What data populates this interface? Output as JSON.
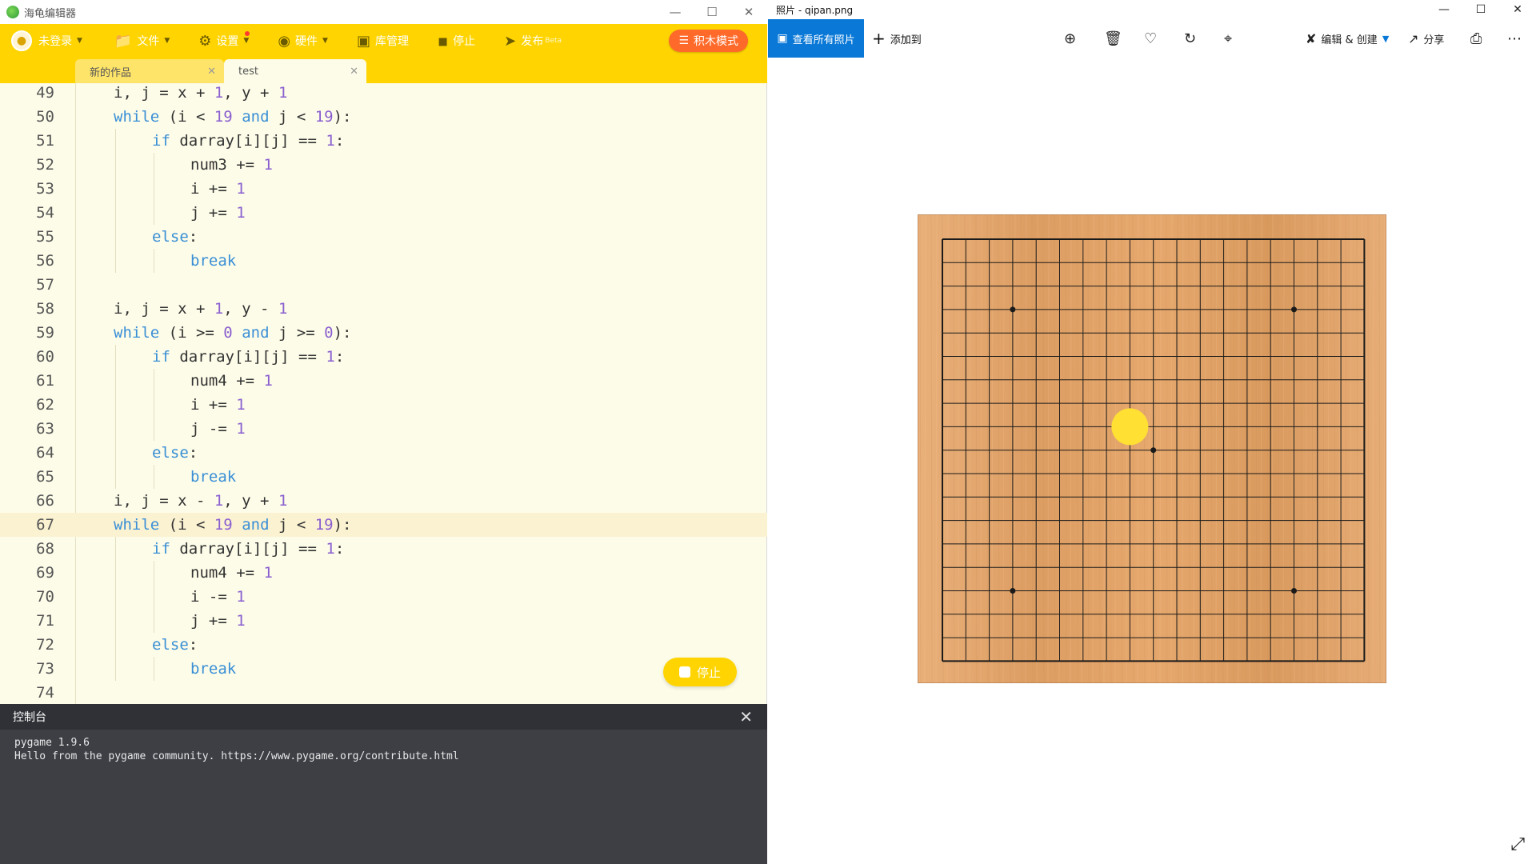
{
  "editor": {
    "window_title": "海龟编辑器",
    "toolbar": {
      "login": "未登录",
      "file": "文件",
      "settings": "设置",
      "hardware": "硬件",
      "library": "库管理",
      "stop": "停止",
      "publish": "发布",
      "publish_badge": "Beta",
      "block_mode": "积木模式"
    },
    "tabs": [
      {
        "label": "新的作品"
      },
      {
        "label": "test"
      }
    ],
    "current_line": 67,
    "lines": [
      {
        "n": "49",
        "indent": 1,
        "code": "i, j = x + 1, y + 1"
      },
      {
        "n": "50",
        "indent": 1,
        "code": "while (i < 19 and j < 19):"
      },
      {
        "n": "51",
        "indent": 2,
        "code": "if darray[i][j] == 1:"
      },
      {
        "n": "52",
        "indent": 3,
        "code": "num3 += 1"
      },
      {
        "n": "53",
        "indent": 3,
        "code": "i += 1"
      },
      {
        "n": "54",
        "indent": 3,
        "code": "j += 1"
      },
      {
        "n": "55",
        "indent": 2,
        "code": "else:"
      },
      {
        "n": "56",
        "indent": 3,
        "code": "break"
      },
      {
        "n": "57",
        "indent": 0,
        "code": ""
      },
      {
        "n": "58",
        "indent": 1,
        "code": "i, j = x + 1, y - 1"
      },
      {
        "n": "59",
        "indent": 1,
        "code": "while (i >= 0 and j >= 0):"
      },
      {
        "n": "60",
        "indent": 2,
        "code": "if darray[i][j] == 1:"
      },
      {
        "n": "61",
        "indent": 3,
        "code": "num4 += 1"
      },
      {
        "n": "62",
        "indent": 3,
        "code": "i += 1"
      },
      {
        "n": "63",
        "indent": 3,
        "code": "j -= 1"
      },
      {
        "n": "64",
        "indent": 2,
        "code": "else:"
      },
      {
        "n": "65",
        "indent": 3,
        "code": "break"
      },
      {
        "n": "66",
        "indent": 1,
        "code": "i, j = x - 1, y + 1"
      },
      {
        "n": "67",
        "indent": 1,
        "code": "while (i < 19 and j < 19):"
      },
      {
        "n": "68",
        "indent": 2,
        "code": "if darray[i][j] == 1:"
      },
      {
        "n": "69",
        "indent": 3,
        "code": "num4 += 1"
      },
      {
        "n": "70",
        "indent": 3,
        "code": "i -= 1"
      },
      {
        "n": "71",
        "indent": 3,
        "code": "j += 1"
      },
      {
        "n": "72",
        "indent": 2,
        "code": "else:"
      },
      {
        "n": "73",
        "indent": 3,
        "code": "break"
      },
      {
        "n": "74",
        "indent": 0,
        "code": ""
      }
    ],
    "stop_button": "停止",
    "console": {
      "title": "控制台",
      "output": "pygame 1.9.6\nHello from the pygame community. https://www.pygame.org/contribute.html"
    }
  },
  "photos": {
    "window_title": "照片 - qipan.png",
    "view_all": "查看所有照片",
    "add_to": "添加到",
    "edit_create": "编辑 & 创建",
    "share": "分享",
    "icons": [
      "zoom-icon",
      "delete-icon",
      "favorite-icon",
      "rotate-icon",
      "crop-icon",
      "print-icon",
      "more-icon"
    ],
    "board": {
      "grid_lines": 19,
      "star_points": [
        [
          3,
          3
        ],
        [
          15,
          3
        ],
        [
          3,
          15
        ],
        [
          15,
          15
        ],
        [
          9,
          9
        ]
      ],
      "stone": {
        "col": 8,
        "row": 8,
        "color": "#ffe033"
      },
      "wood_color": "#e3a86a",
      "line_color": "#1a1a1a"
    }
  }
}
